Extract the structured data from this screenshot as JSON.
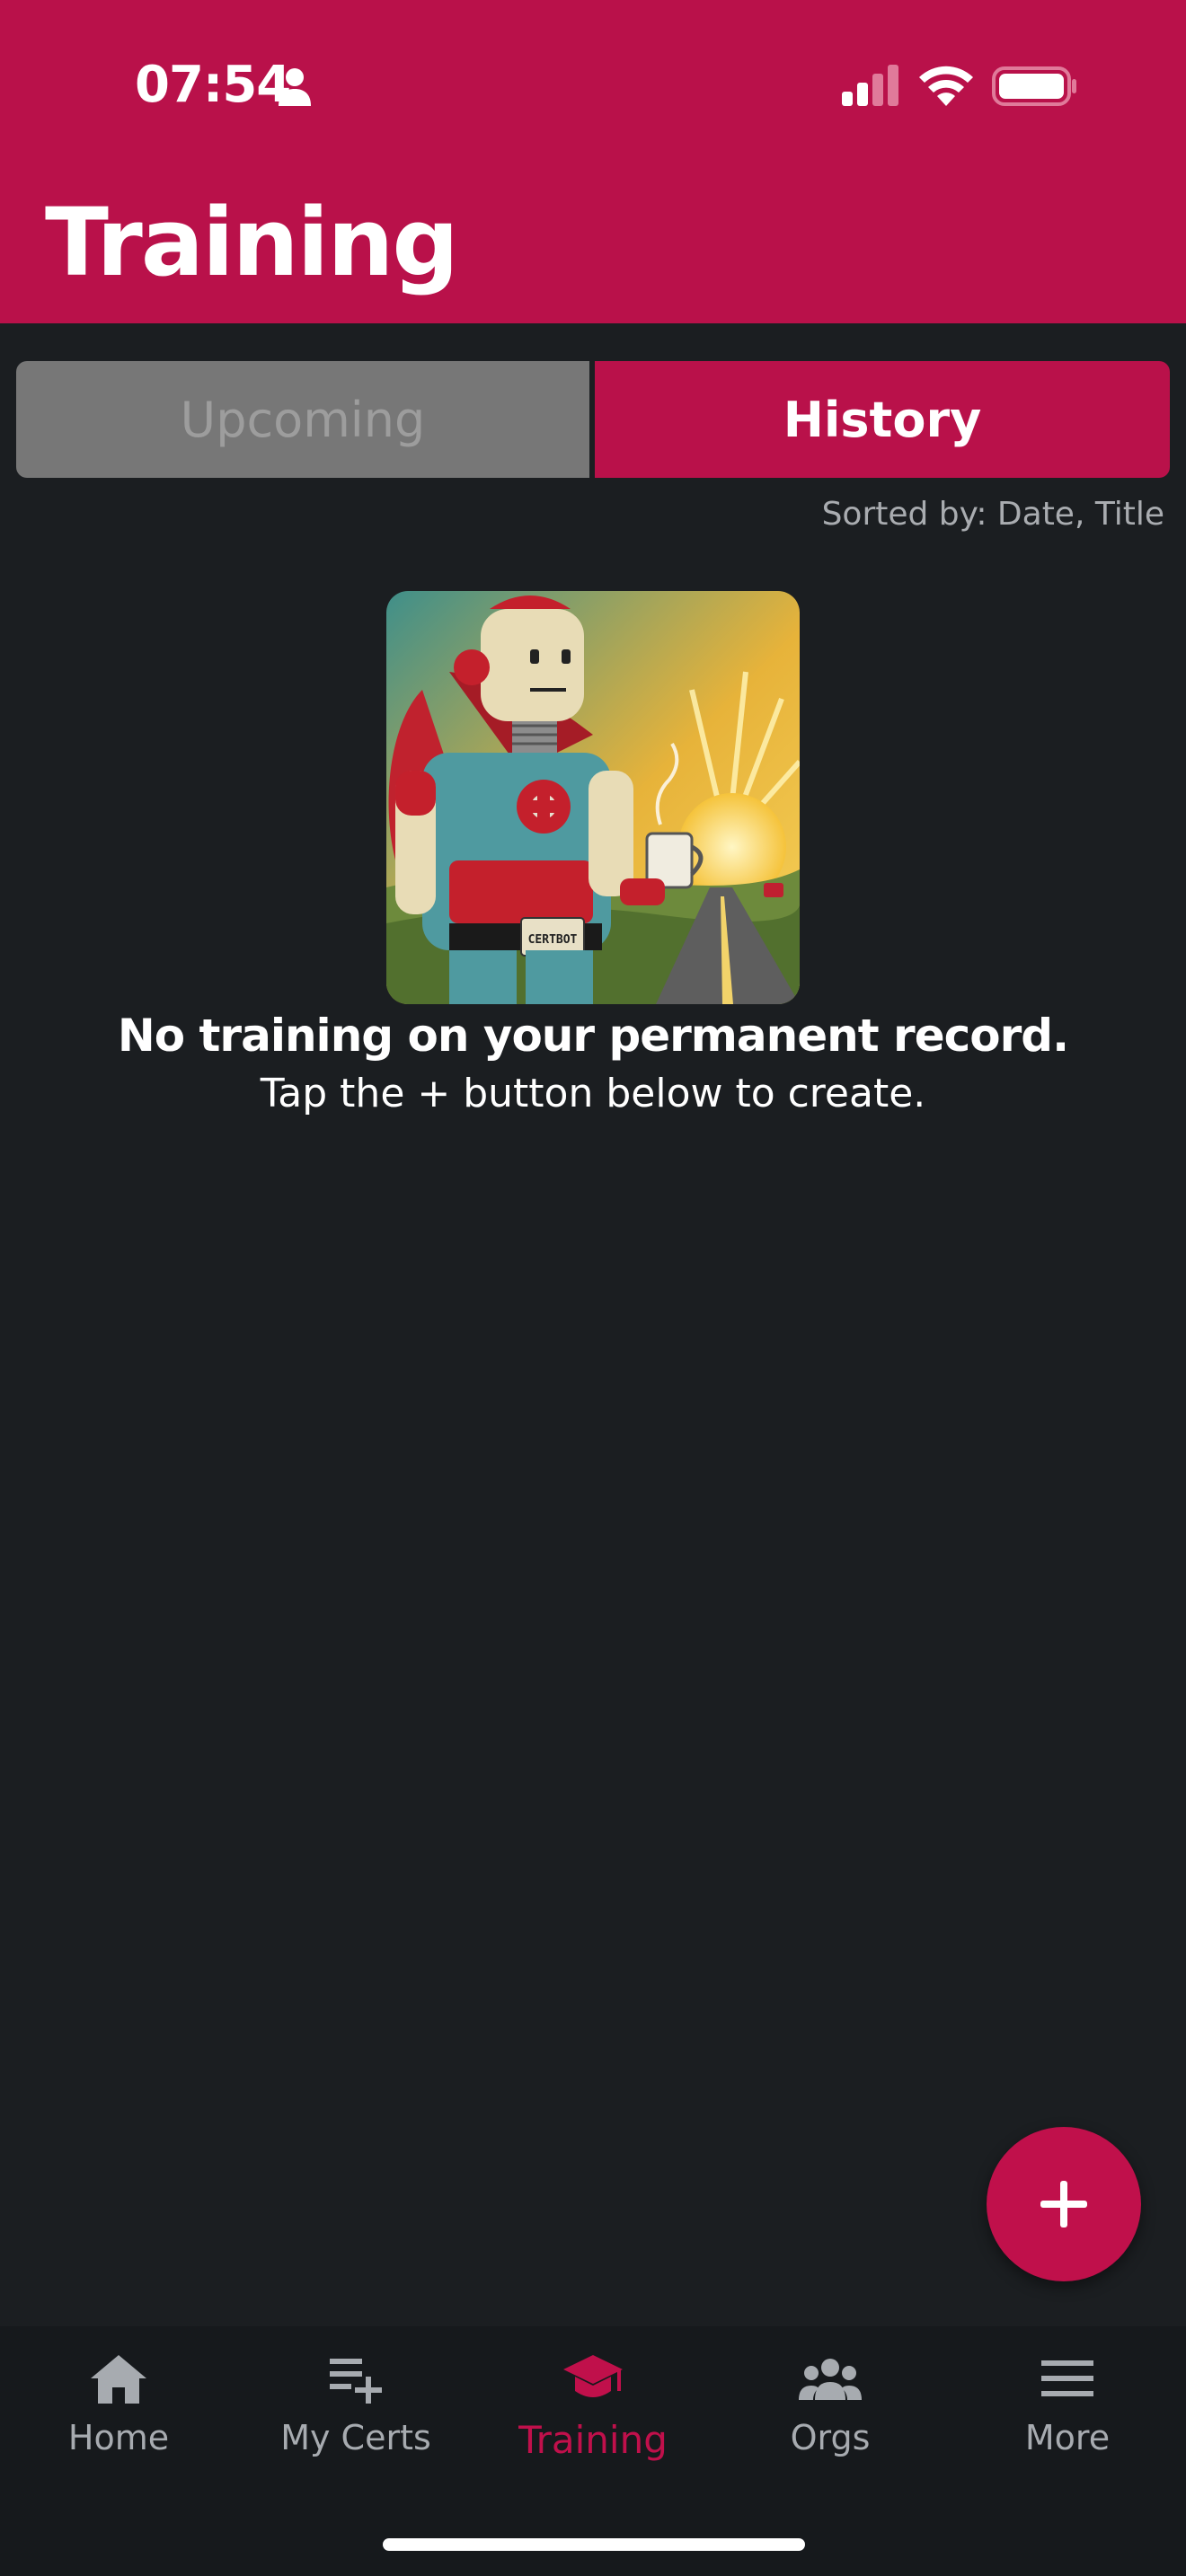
{
  "status_bar": {
    "time": "07:54",
    "icons": [
      "person-icon",
      "cellular-signal-icon",
      "wifi-icon",
      "battery-icon"
    ]
  },
  "header": {
    "title": "Training"
  },
  "tabs": [
    {
      "label": "Upcoming",
      "selected": false
    },
    {
      "label": "History",
      "selected": true
    }
  ],
  "sort": {
    "label": "Sorted by: Date, Title"
  },
  "empty_state": {
    "illustration": "robot-mascot-illustration",
    "badge_text": "CERTBOT",
    "title": "No training on your permanent record.",
    "subtitle": "Tap the + button below to create."
  },
  "fab": {
    "icon": "plus-icon"
  },
  "bottom_nav": {
    "items": [
      {
        "label": "Home",
        "icon": "home-icon",
        "active": false
      },
      {
        "label": "My Certs",
        "icon": "playlist-add-icon",
        "active": false
      },
      {
        "label": "Training",
        "icon": "graduation-cap-icon",
        "active": true
      },
      {
        "label": "Orgs",
        "icon": "group-icon",
        "active": false
      },
      {
        "label": "More",
        "icon": "menu-icon",
        "active": false
      }
    ]
  },
  "colors": {
    "brand": "#b9114a",
    "background": "#1b1e21",
    "nav_background": "#16191c",
    "inactive_tab": "#777777",
    "muted_text": "#a7abb0"
  }
}
